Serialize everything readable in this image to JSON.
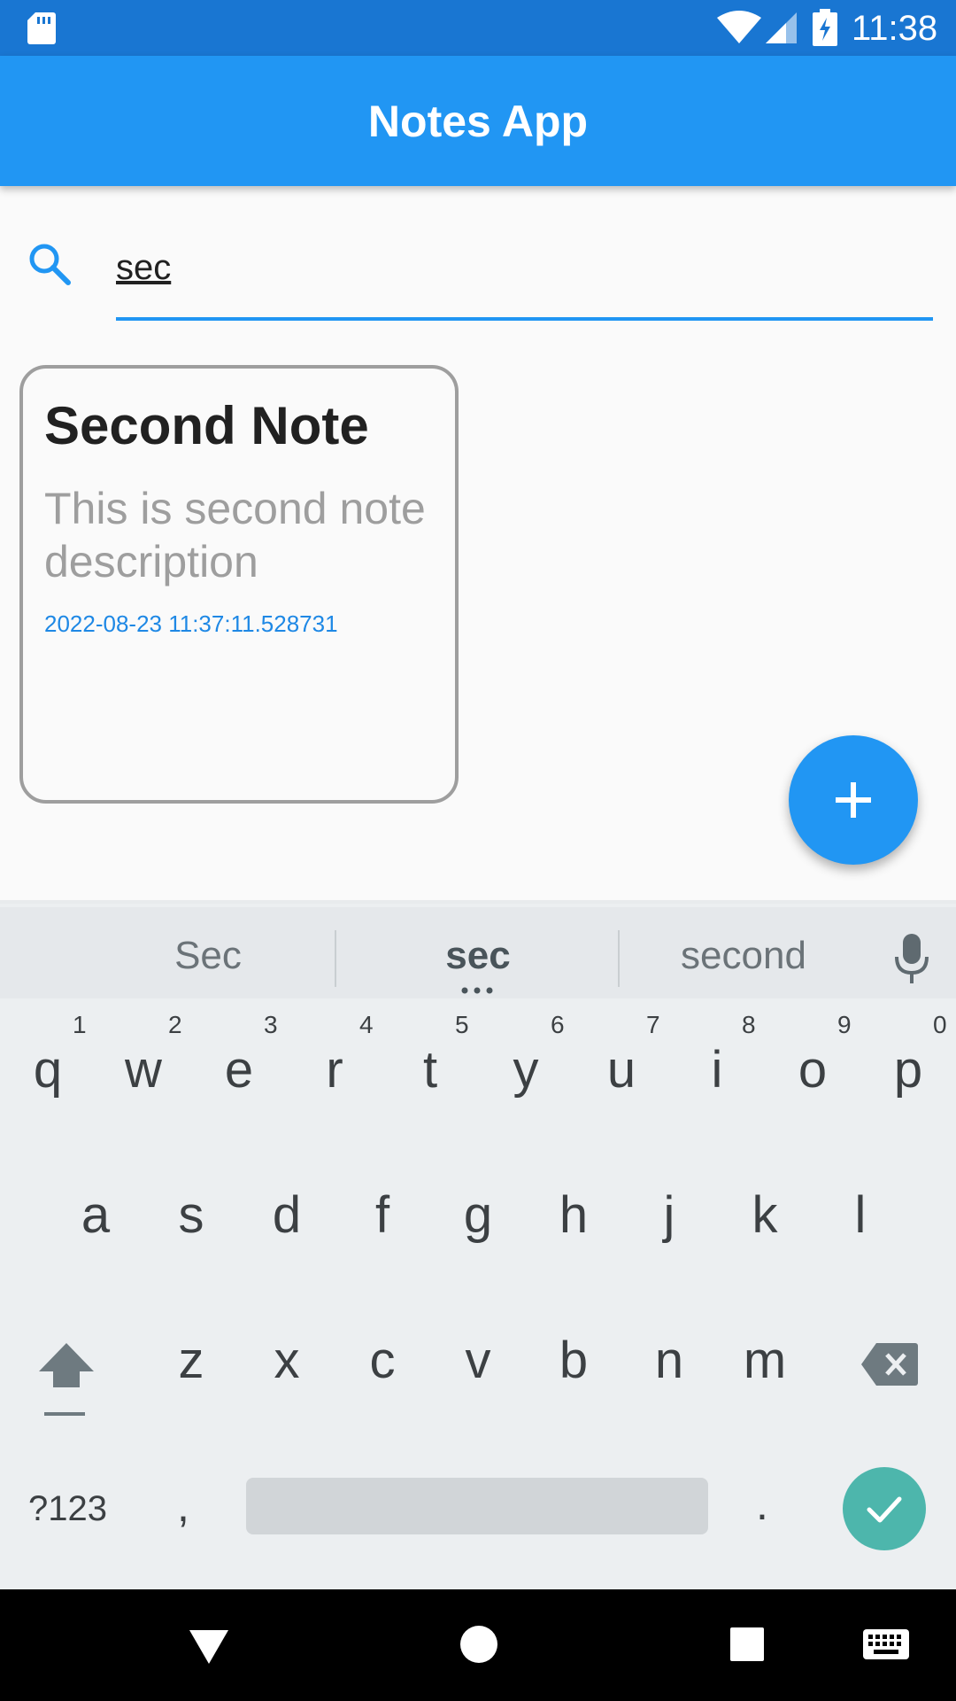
{
  "status_bar": {
    "time": "11:38",
    "icons": [
      "sd-card-icon",
      "wifi-icon",
      "signal-icon",
      "battery-charging-icon"
    ]
  },
  "app_bar": {
    "title": "Notes App"
  },
  "search": {
    "value": "sec",
    "icon": "search-icon"
  },
  "notes": [
    {
      "title": "Second Note",
      "description": "This is second note description",
      "date": "2022-08-23 11:37:11.528731"
    }
  ],
  "fab": {
    "icon": "add-icon"
  },
  "keyboard": {
    "suggestions": [
      "Sec",
      "sec",
      "second"
    ],
    "row1": [
      {
        "key": "q",
        "hint": "1"
      },
      {
        "key": "w",
        "hint": "2"
      },
      {
        "key": "e",
        "hint": "3"
      },
      {
        "key": "r",
        "hint": "4"
      },
      {
        "key": "t",
        "hint": "5"
      },
      {
        "key": "y",
        "hint": "6"
      },
      {
        "key": "u",
        "hint": "7"
      },
      {
        "key": "i",
        "hint": "8"
      },
      {
        "key": "o",
        "hint": "9"
      },
      {
        "key": "p",
        "hint": "0"
      }
    ],
    "row2": [
      "a",
      "s",
      "d",
      "f",
      "g",
      "h",
      "j",
      "k",
      "l"
    ],
    "row3": [
      "z",
      "x",
      "c",
      "v",
      "b",
      "n",
      "m"
    ],
    "symbols_label": "?123",
    "comma": ",",
    "period": ".",
    "accent_color": "#4db6ac"
  },
  "colors": {
    "primary": "#2196f3",
    "primary_dark": "#1976d2",
    "date_text": "#1e88e5"
  }
}
